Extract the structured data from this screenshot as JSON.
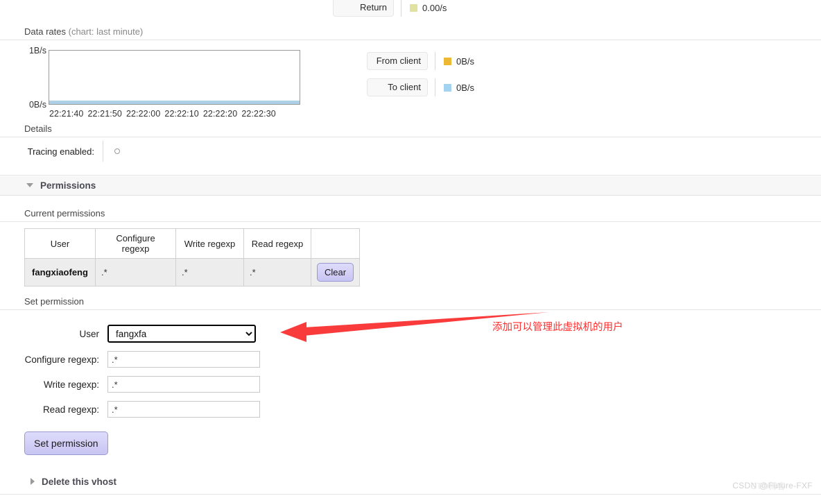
{
  "top_stat": {
    "button_label": "Return",
    "value": "0.00/s",
    "swatch_color": "#e2e2a0"
  },
  "data_rates": {
    "heading": "Data rates",
    "sub_heading": "(chart: last minute)",
    "legend": [
      {
        "button_label": "From client",
        "value": "0B/s",
        "color": "#edb833"
      },
      {
        "button_label": "To client",
        "value": "0B/s",
        "color": "#a3d3f0"
      }
    ]
  },
  "chart_data": {
    "type": "area",
    "title": "Data rates",
    "subtitle": "(chart: last minute)",
    "xlabel": "",
    "ylabel": "",
    "ylim": [
      0,
      1
    ],
    "ytick_labels": [
      "1B/s",
      "0B/s"
    ],
    "x": [
      "22:21:40",
      "22:21:50",
      "22:22:00",
      "22:22:10",
      "22:22:20",
      "22:22:30"
    ],
    "grid": false,
    "legend_position": "right",
    "series": [
      {
        "name": "From client",
        "color": "#edb833",
        "values": [
          0,
          0,
          0,
          0,
          0,
          0
        ],
        "current": "0B/s"
      },
      {
        "name": "To client",
        "color": "#a3d3f0",
        "values": [
          0,
          0,
          0,
          0,
          0,
          0
        ],
        "current": "0B/s"
      }
    ]
  },
  "details": {
    "heading": "Details",
    "tracing_label": "Tracing enabled:",
    "tracing_value": ""
  },
  "permissions_section": {
    "title": "Permissions",
    "expanded": true,
    "current_heading": "Current permissions",
    "table": {
      "columns": [
        "User",
        "Configure regexp",
        "Write regexp",
        "Read regexp",
        ""
      ],
      "rows": [
        {
          "user": "fangxiaofeng",
          "configure": ".*",
          "write": ".*",
          "read": ".*",
          "action_label": "Clear"
        }
      ]
    },
    "set_heading": "Set permission",
    "form": {
      "user_label": "User",
      "user_value": "fangxfa",
      "user_options": [
        "fangxfa"
      ],
      "configure_label": "Configure regexp:",
      "configure_value": ".*",
      "write_label": "Write regexp:",
      "write_value": ".*",
      "read_label": "Read regexp:",
      "read_value": ".*",
      "submit_label": "Set permission"
    }
  },
  "delete_section": {
    "title": "Delete this vhost",
    "expanded": false
  },
  "annotation": {
    "text": "添加可以管理此虚拟机的用户",
    "color": "#ff2d2d"
  },
  "watermark": {
    "text": "CSDN @Future-FXF",
    "ghost": "CTO博客"
  }
}
